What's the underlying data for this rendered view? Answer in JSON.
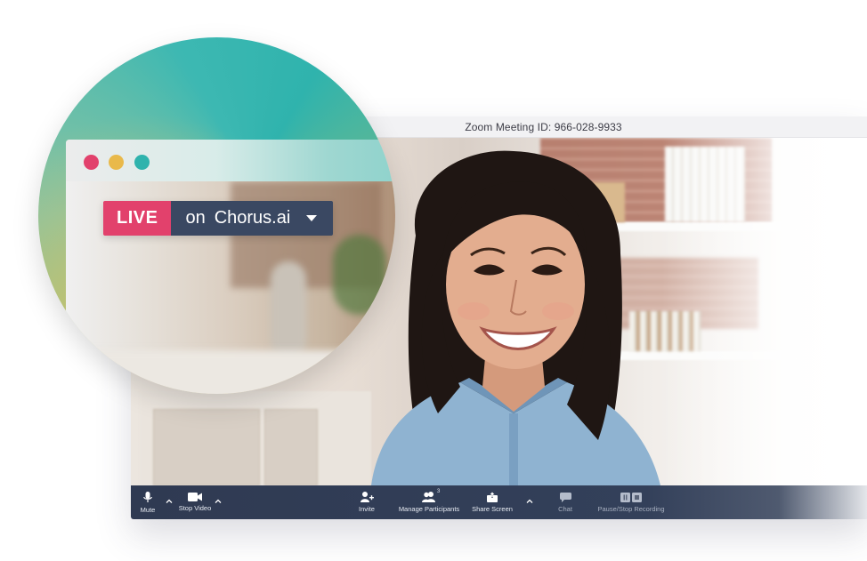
{
  "meeting": {
    "title": "Zoom Meeting ID: 966-028-9933"
  },
  "overlay": {
    "live_label": "LIVE",
    "on_label": "on",
    "brand": "Chorus.ai",
    "dots": [
      "#e2416c",
      "#e9b94a",
      "#2fb3ad"
    ]
  },
  "toolbar": {
    "mute": "Mute",
    "stop_video": "Stop Video",
    "invite": "Invite",
    "manage_participants": "Manage Participants",
    "participant_count": "3",
    "share_screen": "Share Screen",
    "chat": "Chat",
    "pause_recording": "Pause/Stop Recording"
  },
  "colors": {
    "live": "#e2416c",
    "pill_dark": "#3a4862",
    "toolbar": "#2f3a52",
    "teal": "#2fb3ad"
  }
}
